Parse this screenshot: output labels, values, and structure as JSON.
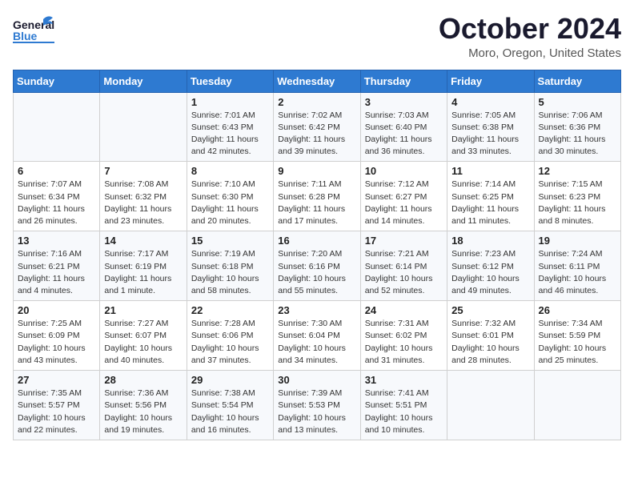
{
  "header": {
    "logo_general": "General",
    "logo_blue": "Blue",
    "month_title": "October 2024",
    "location": "Moro, Oregon, United States"
  },
  "days_of_week": [
    "Sunday",
    "Monday",
    "Tuesday",
    "Wednesday",
    "Thursday",
    "Friday",
    "Saturday"
  ],
  "weeks": [
    [
      {
        "day": "",
        "content": ""
      },
      {
        "day": "",
        "content": ""
      },
      {
        "day": "1",
        "sunrise": "Sunrise: 7:01 AM",
        "sunset": "Sunset: 6:43 PM",
        "daylight": "Daylight: 11 hours and 42 minutes."
      },
      {
        "day": "2",
        "sunrise": "Sunrise: 7:02 AM",
        "sunset": "Sunset: 6:42 PM",
        "daylight": "Daylight: 11 hours and 39 minutes."
      },
      {
        "day": "3",
        "sunrise": "Sunrise: 7:03 AM",
        "sunset": "Sunset: 6:40 PM",
        "daylight": "Daylight: 11 hours and 36 minutes."
      },
      {
        "day": "4",
        "sunrise": "Sunrise: 7:05 AM",
        "sunset": "Sunset: 6:38 PM",
        "daylight": "Daylight: 11 hours and 33 minutes."
      },
      {
        "day": "5",
        "sunrise": "Sunrise: 7:06 AM",
        "sunset": "Sunset: 6:36 PM",
        "daylight": "Daylight: 11 hours and 30 minutes."
      }
    ],
    [
      {
        "day": "6",
        "sunrise": "Sunrise: 7:07 AM",
        "sunset": "Sunset: 6:34 PM",
        "daylight": "Daylight: 11 hours and 26 minutes."
      },
      {
        "day": "7",
        "sunrise": "Sunrise: 7:08 AM",
        "sunset": "Sunset: 6:32 PM",
        "daylight": "Daylight: 11 hours and 23 minutes."
      },
      {
        "day": "8",
        "sunrise": "Sunrise: 7:10 AM",
        "sunset": "Sunset: 6:30 PM",
        "daylight": "Daylight: 11 hours and 20 minutes."
      },
      {
        "day": "9",
        "sunrise": "Sunrise: 7:11 AM",
        "sunset": "Sunset: 6:28 PM",
        "daylight": "Daylight: 11 hours and 17 minutes."
      },
      {
        "day": "10",
        "sunrise": "Sunrise: 7:12 AM",
        "sunset": "Sunset: 6:27 PM",
        "daylight": "Daylight: 11 hours and 14 minutes."
      },
      {
        "day": "11",
        "sunrise": "Sunrise: 7:14 AM",
        "sunset": "Sunset: 6:25 PM",
        "daylight": "Daylight: 11 hours and 11 minutes."
      },
      {
        "day": "12",
        "sunrise": "Sunrise: 7:15 AM",
        "sunset": "Sunset: 6:23 PM",
        "daylight": "Daylight: 11 hours and 8 minutes."
      }
    ],
    [
      {
        "day": "13",
        "sunrise": "Sunrise: 7:16 AM",
        "sunset": "Sunset: 6:21 PM",
        "daylight": "Daylight: 11 hours and 4 minutes."
      },
      {
        "day": "14",
        "sunrise": "Sunrise: 7:17 AM",
        "sunset": "Sunset: 6:19 PM",
        "daylight": "Daylight: 11 hours and 1 minute."
      },
      {
        "day": "15",
        "sunrise": "Sunrise: 7:19 AM",
        "sunset": "Sunset: 6:18 PM",
        "daylight": "Daylight: 10 hours and 58 minutes."
      },
      {
        "day": "16",
        "sunrise": "Sunrise: 7:20 AM",
        "sunset": "Sunset: 6:16 PM",
        "daylight": "Daylight: 10 hours and 55 minutes."
      },
      {
        "day": "17",
        "sunrise": "Sunrise: 7:21 AM",
        "sunset": "Sunset: 6:14 PM",
        "daylight": "Daylight: 10 hours and 52 minutes."
      },
      {
        "day": "18",
        "sunrise": "Sunrise: 7:23 AM",
        "sunset": "Sunset: 6:12 PM",
        "daylight": "Daylight: 10 hours and 49 minutes."
      },
      {
        "day": "19",
        "sunrise": "Sunrise: 7:24 AM",
        "sunset": "Sunset: 6:11 PM",
        "daylight": "Daylight: 10 hours and 46 minutes."
      }
    ],
    [
      {
        "day": "20",
        "sunrise": "Sunrise: 7:25 AM",
        "sunset": "Sunset: 6:09 PM",
        "daylight": "Daylight: 10 hours and 43 minutes."
      },
      {
        "day": "21",
        "sunrise": "Sunrise: 7:27 AM",
        "sunset": "Sunset: 6:07 PM",
        "daylight": "Daylight: 10 hours and 40 minutes."
      },
      {
        "day": "22",
        "sunrise": "Sunrise: 7:28 AM",
        "sunset": "Sunset: 6:06 PM",
        "daylight": "Daylight: 10 hours and 37 minutes."
      },
      {
        "day": "23",
        "sunrise": "Sunrise: 7:30 AM",
        "sunset": "Sunset: 6:04 PM",
        "daylight": "Daylight: 10 hours and 34 minutes."
      },
      {
        "day": "24",
        "sunrise": "Sunrise: 7:31 AM",
        "sunset": "Sunset: 6:02 PM",
        "daylight": "Daylight: 10 hours and 31 minutes."
      },
      {
        "day": "25",
        "sunrise": "Sunrise: 7:32 AM",
        "sunset": "Sunset: 6:01 PM",
        "daylight": "Daylight: 10 hours and 28 minutes."
      },
      {
        "day": "26",
        "sunrise": "Sunrise: 7:34 AM",
        "sunset": "Sunset: 5:59 PM",
        "daylight": "Daylight: 10 hours and 25 minutes."
      }
    ],
    [
      {
        "day": "27",
        "sunrise": "Sunrise: 7:35 AM",
        "sunset": "Sunset: 5:57 PM",
        "daylight": "Daylight: 10 hours and 22 minutes."
      },
      {
        "day": "28",
        "sunrise": "Sunrise: 7:36 AM",
        "sunset": "Sunset: 5:56 PM",
        "daylight": "Daylight: 10 hours and 19 minutes."
      },
      {
        "day": "29",
        "sunrise": "Sunrise: 7:38 AM",
        "sunset": "Sunset: 5:54 PM",
        "daylight": "Daylight: 10 hours and 16 minutes."
      },
      {
        "day": "30",
        "sunrise": "Sunrise: 7:39 AM",
        "sunset": "Sunset: 5:53 PM",
        "daylight": "Daylight: 10 hours and 13 minutes."
      },
      {
        "day": "31",
        "sunrise": "Sunrise: 7:41 AM",
        "sunset": "Sunset: 5:51 PM",
        "daylight": "Daylight: 10 hours and 10 minutes."
      },
      {
        "day": "",
        "content": ""
      },
      {
        "day": "",
        "content": ""
      }
    ]
  ]
}
